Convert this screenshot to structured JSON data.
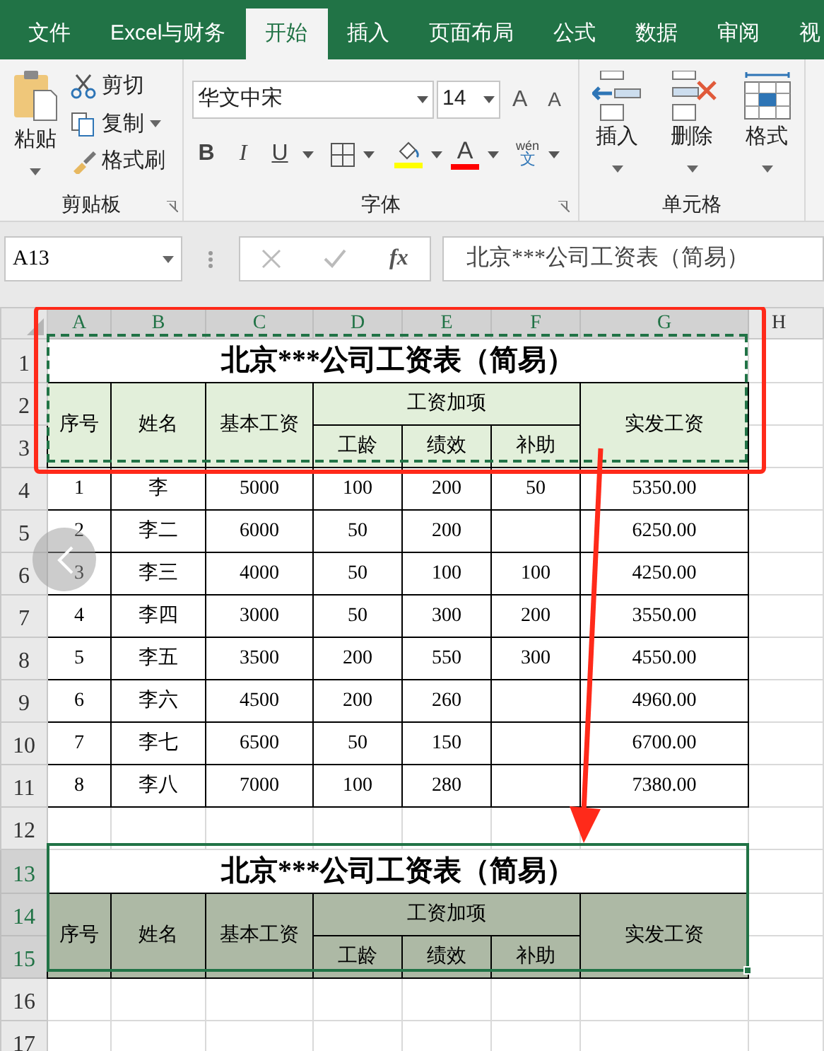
{
  "tabs": [
    {
      "label": "文件",
      "selected": false
    },
    {
      "label": "Excel与财务",
      "selected": false
    },
    {
      "label": "开始",
      "selected": true
    },
    {
      "label": "插入",
      "selected": false
    },
    {
      "label": "页面布局",
      "selected": false
    },
    {
      "label": "公式",
      "selected": false
    },
    {
      "label": "数据",
      "selected": false
    },
    {
      "label": "审阅",
      "selected": false
    },
    {
      "label": "视",
      "selected": false
    }
  ],
  "clipboard": {
    "paste": "粘贴",
    "cut": "剪切",
    "copy": "复制",
    "format_painter": "格式刷",
    "label": "剪贴板"
  },
  "font": {
    "name": "华文中宋",
    "size": "14",
    "grow": "A",
    "shrink": "A",
    "bold": "B",
    "italic": "I",
    "underline": "U",
    "font_color": "A",
    "phonetic_top": "wén",
    "phonetic_bottom": "文",
    "label": "字体"
  },
  "cells": {
    "insert": "插入",
    "delete": "删除",
    "format": "格式",
    "label": "单元格"
  },
  "name_box": "A13",
  "function_label": "fx",
  "formula": "北京***公司工资表（简易）",
  "columns": [
    {
      "label": "A",
      "selected": true
    },
    {
      "label": "B",
      "selected": true
    },
    {
      "label": "C",
      "selected": true
    },
    {
      "label": "D",
      "selected": true
    },
    {
      "label": "E",
      "selected": true
    },
    {
      "label": "F",
      "selected": true
    },
    {
      "label": "G",
      "selected": true
    },
    {
      "label": "H",
      "selected": false
    }
  ],
  "row_numbers": [
    {
      "label": "1",
      "selected": false
    },
    {
      "label": "2",
      "selected": false
    },
    {
      "label": "3",
      "selected": false
    },
    {
      "label": "4",
      "selected": false
    },
    {
      "label": "5",
      "selected": false
    },
    {
      "label": "6",
      "selected": false
    },
    {
      "label": "7",
      "selected": false
    },
    {
      "label": "8",
      "selected": false
    },
    {
      "label": "9",
      "selected": false
    },
    {
      "label": "10",
      "selected": false
    },
    {
      "label": "11",
      "selected": false
    },
    {
      "label": "12",
      "selected": false
    },
    {
      "label": "13",
      "selected": true
    },
    {
      "label": "14",
      "selected": true
    },
    {
      "label": "15",
      "selected": true
    },
    {
      "label": "16",
      "selected": false
    },
    {
      "label": "17",
      "selected": false
    }
  ],
  "source_table": {
    "title": "北京***公司工资表（简易）",
    "headers": {
      "number": "序号",
      "name": "姓名",
      "base_pay": "基本工资",
      "additions": "工资加项",
      "seniority": "工龄",
      "performance": "绩效",
      "allowance": "补助",
      "net_pay": "实发工资"
    },
    "rows": [
      {
        "number": "1",
        "name": "李",
        "base_pay": "5000",
        "seniority": "100",
        "performance": "200",
        "allowance": "50",
        "net_pay": "5350.00"
      },
      {
        "number": "2",
        "name": "李二",
        "base_pay": "6000",
        "seniority": "50",
        "performance": "200",
        "net_pay": "6250.00"
      },
      {
        "number": "3",
        "name": "李三",
        "base_pay": "4000",
        "seniority": "50",
        "performance": "100",
        "allowance": "100",
        "net_pay": "4250.00"
      },
      {
        "number": "4",
        "name": "李四",
        "base_pay": "3000",
        "seniority": "50",
        "performance": "300",
        "allowance": "200",
        "net_pay": "3550.00"
      },
      {
        "number": "5",
        "name": "李五",
        "base_pay": "3500",
        "seniority": "200",
        "performance": "550",
        "allowance": "300",
        "net_pay": "4550.00"
      },
      {
        "number": "6",
        "name": "李六",
        "base_pay": "4500",
        "seniority": "200",
        "performance": "260",
        "net_pay": "4960.00"
      },
      {
        "number": "7",
        "name": "李七",
        "base_pay": "6500",
        "seniority": "50",
        "performance": "150",
        "net_pay": "6700.00"
      },
      {
        "number": "8",
        "name": "李八",
        "base_pay": "7000",
        "seniority": "100",
        "performance": "280",
        "net_pay": "7380.00"
      }
    ]
  },
  "copied_table": {
    "title": "北京***公司工资表（简易）",
    "headers": {
      "number": "序号",
      "name": "姓名",
      "base_pay": "基本工资",
      "additions": "工资加项",
      "seniority": "工龄",
      "performance": "绩效",
      "allowance": "补助",
      "net_pay": "实发工资"
    }
  }
}
